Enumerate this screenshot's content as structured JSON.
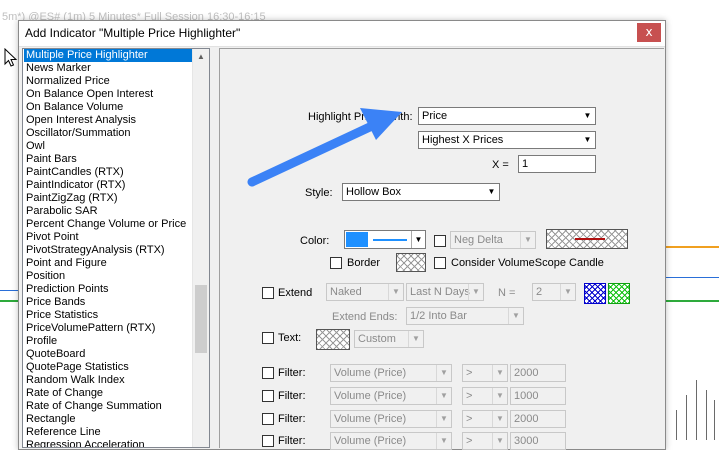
{
  "background": {
    "chart_title": "5m*) @ES# (1m) 5 Minutes* Full Session 16:30-16:15"
  },
  "dialog": {
    "title": "Add Indicator \"Multiple Price Highlighter\"",
    "close_label": "x"
  },
  "indicator_list": {
    "items": [
      "Multiple Price Highlighter",
      "News Marker",
      "Normalized Price",
      "On Balance Open Interest",
      "On Balance Volume",
      "Open Interest Analysis",
      "Oscillator/Summation",
      "Owl",
      "Paint Bars",
      "PaintCandles (RTX)",
      "PaintIndicator (RTX)",
      "PaintZigZag (RTX)",
      "Parabolic SAR",
      "Percent Change Volume or Price",
      "Pivot Point",
      "PivotStrategyAnalysis (RTX)",
      "Point and Figure",
      "Position",
      "Prediction Points",
      "Price Bands",
      "Price Statistics",
      "PriceVolumePattern (RTX)",
      "Profile",
      "QuoteBoard",
      "QuotePage Statistics",
      "Random Walk Index",
      "Rate of Change",
      "Rate of Change Summation",
      "Rectangle",
      "Reference Line",
      "Regression Acceleration"
    ],
    "selected": "Multiple Price Highlighter"
  },
  "settings": {
    "highlight_label": "Highlight Prices With:",
    "highlight_value": "Price",
    "mode_value": "Highest X Prices",
    "x_label": "X =",
    "x_value": "1",
    "style_label": "Style:",
    "style_value": "Hollow Box",
    "color_label": "Color:",
    "neg_delta_label": "Neg Delta",
    "border_label": "Border",
    "consider_label": "Consider VolumeScope Candle",
    "extend_label": "Extend",
    "extend_type": "Naked",
    "extend_range": "Last N Days",
    "n_label": "N =",
    "n_value": "2",
    "extend_ends_label": "Extend Ends:",
    "extend_ends_value": "1/2 Into Bar",
    "text_label": "Text:",
    "text_value": "Custom",
    "filter_label": "Filter:",
    "filters": [
      {
        "field": "Volume (Price)",
        "op": ">",
        "value": "2000"
      },
      {
        "field": "Volume (Price)",
        "op": ">",
        "value": "1000"
      },
      {
        "field": "Volume (Price)",
        "op": ">",
        "value": "2000"
      },
      {
        "field": "Volume (Price)",
        "op": ">",
        "value": "3000"
      }
    ]
  },
  "colors": {
    "selection": "#0078d7",
    "primary_color": "#1e90ff",
    "arrow": "#3b82f6",
    "chart_green": "#2eaa3c",
    "chart_orange": "#f0a020",
    "chart_blue": "#2a6fd8",
    "close_button": "#c75050"
  }
}
